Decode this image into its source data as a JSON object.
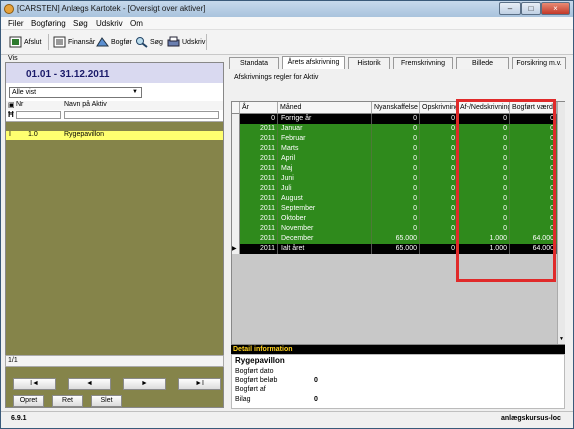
{
  "window": {
    "title": "[CARSTEN] Anlægs Kartotek - [Oversigt over aktiver]",
    "controls": [
      "–",
      "□",
      "×"
    ]
  },
  "menu": [
    "Filer",
    "Bogføring",
    "Søg",
    "Udskriv",
    "Om"
  ],
  "toolbar": [
    "Afslut",
    "Finansår",
    "Bogfør",
    "Søg",
    "Udskriv"
  ],
  "vis_label": "Vis",
  "left": {
    "period": "01.01 - 31.12.2011",
    "filter": "Alle vist",
    "headers": [
      "Nr",
      "Navn på Aktiv"
    ],
    "rows": [
      {
        "marker": "I",
        "nr": "1.0",
        "name": "Rygepavillon"
      }
    ],
    "status": "1/1",
    "nav": [
      "I◄",
      "◄",
      "►",
      "►I"
    ],
    "actions": [
      "Opret",
      "Ret",
      "Slet"
    ]
  },
  "tabs": [
    "Standata",
    "Årets afskrivning",
    "Historik",
    "Fremskrivning",
    "Billede",
    "Forsikring m.v."
  ],
  "subtitle": "Afskrivnings regler for Aktiv",
  "table": {
    "headers": [
      "År",
      "Måned",
      "Nyanskaffelse",
      "Opskrivning",
      "Af-/Nedskrivning",
      "Bogført værdi"
    ],
    "rows": [
      [
        "0",
        "Forrige år",
        "0",
        "0",
        "0",
        "0"
      ],
      [
        "2011",
        "Januar",
        "0",
        "0",
        "0",
        "0"
      ],
      [
        "2011",
        "Februar",
        "0",
        "0",
        "0",
        "0"
      ],
      [
        "2011",
        "Marts",
        "0",
        "0",
        "0",
        "0"
      ],
      [
        "2011",
        "April",
        "0",
        "0",
        "0",
        "0"
      ],
      [
        "2011",
        "Maj",
        "0",
        "0",
        "0",
        "0"
      ],
      [
        "2011",
        "Juni",
        "0",
        "0",
        "0",
        "0"
      ],
      [
        "2011",
        "Juli",
        "0",
        "0",
        "0",
        "0"
      ],
      [
        "2011",
        "August",
        "0",
        "0",
        "0",
        "0"
      ],
      [
        "2011",
        "September",
        "0",
        "0",
        "0",
        "0"
      ],
      [
        "2011",
        "Oktober",
        "0",
        "0",
        "0",
        "0"
      ],
      [
        "2011",
        "November",
        "0",
        "0",
        "0",
        "0"
      ],
      [
        "2011",
        "December",
        "65.000",
        "0",
        "1.000",
        "64.000"
      ],
      [
        "2011",
        "Ialt året",
        "65.000",
        "0",
        "1.000",
        "64.000"
      ]
    ]
  },
  "detail": {
    "title": "Detail information",
    "asset": "Rygepavillon",
    "labels": [
      "Bogført dato",
      "Bogført beløb",
      "Bogført af",
      "Bilag"
    ],
    "values": [
      "",
      "0",
      "",
      "0"
    ]
  },
  "status": {
    "version": "6.9.1",
    "database": "anlægskursus-loc"
  },
  "colors": {
    "green_row": "#2f8a1c",
    "black_row": "#000000",
    "highlight_box": "#e02a2a",
    "left_bg": "#85844a"
  }
}
